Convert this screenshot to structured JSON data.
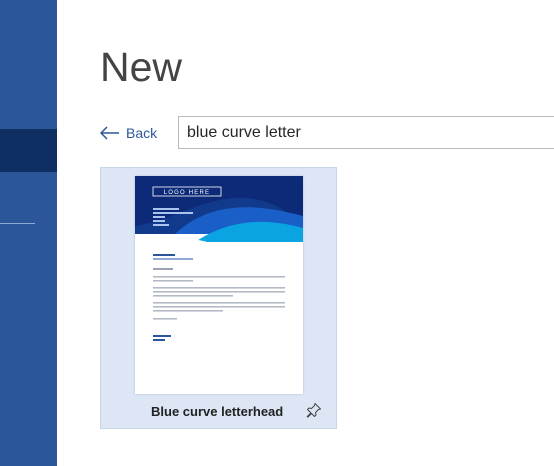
{
  "page": {
    "title": "New"
  },
  "back": {
    "label": "Back"
  },
  "search": {
    "value": "blue curve letter"
  },
  "template": {
    "name": "Blue curve letterhead",
    "logo_text": "LOGO HERE"
  },
  "icons": {
    "back": "arrow-left-icon",
    "pin": "pin-icon"
  },
  "colors": {
    "sidebar": "#2b579a",
    "sidebar_selected": "#0f2f63",
    "accent": "#2b579a",
    "card_bg": "#dce6f4"
  }
}
